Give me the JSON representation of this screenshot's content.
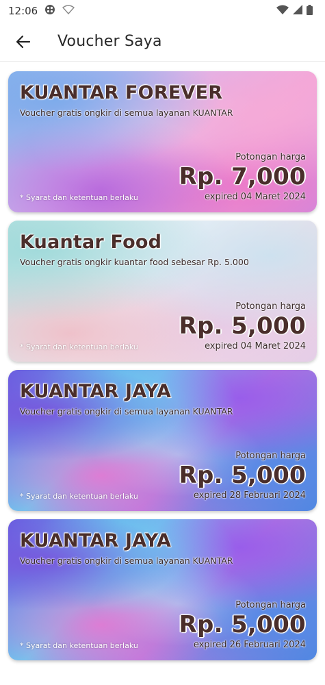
{
  "status_bar": {
    "time": "12:06",
    "icons": [
      "app-badge-icon",
      "wifi-icon",
      "signal-icon",
      "battery-icon"
    ]
  },
  "app_bar": {
    "title": "Voucher Saya",
    "back_icon": "arrow-left-icon"
  },
  "vouchers": [
    {
      "title": "KUANTAR FOREVER",
      "description": "Voucher gratis ongkir di semua layanan KUANTAR",
      "discount_label": "Potongan harga",
      "amount": "Rp. 7,000",
      "expiry": "expired 04 Maret 2024",
      "terms": "* Syarat dan ketentuan berlaku"
    },
    {
      "title": "Kuantar Food",
      "description": "Voucher gratis ongkir kuantar food sebesar Rp. 5.000",
      "discount_label": "Potongan harga",
      "amount": "Rp. 5,000",
      "expiry": "expired 04 Maret 2024",
      "terms": "* Syarat dan ketentuan berlaku"
    },
    {
      "title": "KUANTAR JAYA",
      "description": "Voucher gratis ongkir di semua layanan KUANTAR",
      "discount_label": "Potongan harga",
      "amount": "Rp. 5,000",
      "expiry": "expired 28 Februari 2024",
      "terms": "* Syarat dan ketentuan berlaku"
    },
    {
      "title": "KUANTAR JAYA",
      "description": "Voucher gratis ongkir di semua layanan KUANTAR",
      "discount_label": "Potongan harga",
      "amount": "Rp. 5,000",
      "expiry": "expired 26 Februari 2024",
      "terms": "* Syarat dan ketentuan berlaku"
    }
  ],
  "colors": {
    "title_text": "#4a2e2b",
    "body_text": "#3a2a2a",
    "background": "#ffffff"
  }
}
